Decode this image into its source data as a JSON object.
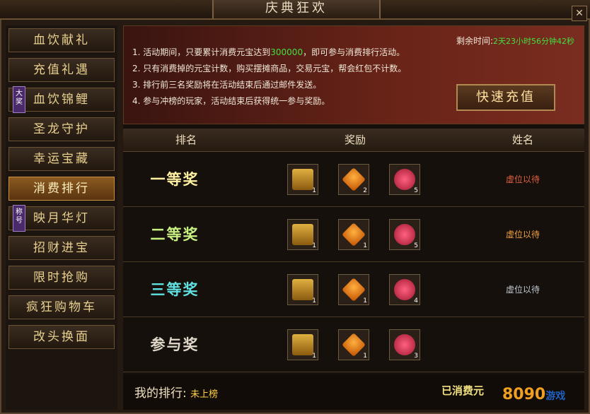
{
  "window": {
    "title": "庆典狂欢",
    "close_icon": "close-icon"
  },
  "sidebar": {
    "items": [
      {
        "label": "血饮献礼"
      },
      {
        "label": "充值礼遇"
      },
      {
        "label": "血饮锦鲤",
        "badge": "大奖"
      },
      {
        "label": "圣龙守护"
      },
      {
        "label": "幸运宝藏"
      },
      {
        "label": "消费排行",
        "active": true
      },
      {
        "label": "映月华灯",
        "badge": "称号"
      },
      {
        "label": "招财进宝"
      },
      {
        "label": "限时抢购"
      },
      {
        "label": "疯狂购物车"
      },
      {
        "label": "改头换面"
      }
    ]
  },
  "banner": {
    "rules": [
      {
        "a": "1. 活动期间，只要累计消费元宝达到",
        "hl": "300000",
        "b": "，即可参与消费排行活动。"
      },
      {
        "a": "2. 只有消费掉的元宝计数，购买摆摊商品，交易元宝，帮会红包不计数。"
      },
      {
        "a": "3. 排行前三名奖励将在活动结束后通过邮件发送。"
      },
      {
        "a": "4. 参与冲榜的玩家，活动结束后获得统一参与奖励。"
      }
    ],
    "remain_label": "剩余时间:",
    "remain_value": "2天23小时56分钟42秒",
    "recharge_label": "快速充值"
  },
  "table": {
    "headers": {
      "rank": "排名",
      "reward": "奖励",
      "name": "姓名"
    },
    "rows": [
      {
        "rank": "一等奖",
        "color": "#fff0a0",
        "items": [
          {
            "icon": "chest-icon",
            "count": "1"
          },
          {
            "icon": "gem-icon",
            "count": "2"
          },
          {
            "icon": "rose-icon",
            "count": "5"
          }
        ],
        "name": "虚位以待",
        "name_color": "#e06040"
      },
      {
        "rank": "二等奖",
        "color": "#c8f080",
        "items": [
          {
            "icon": "chest-icon",
            "count": "1"
          },
          {
            "icon": "gem-icon",
            "count": "1"
          },
          {
            "icon": "rose-icon",
            "count": "5"
          }
        ],
        "name": "虚位以待",
        "name_color": "#f0a040"
      },
      {
        "rank": "三等奖",
        "color": "#60e0e0",
        "items": [
          {
            "icon": "chest-icon",
            "count": "1"
          },
          {
            "icon": "gem-icon",
            "count": "1"
          },
          {
            "icon": "rose-icon",
            "count": "4"
          }
        ],
        "name": "虚位以待",
        "name_color": "#c0c8d0"
      },
      {
        "rank": "参与奖",
        "color": "#e0d8c8",
        "items": [
          {
            "icon": "chest-icon",
            "count": "1"
          },
          {
            "icon": "gem-icon",
            "count": "1"
          },
          {
            "icon": "rose-icon",
            "count": "3"
          }
        ],
        "name": "",
        "name_color": "#c0c0c0"
      }
    ]
  },
  "footer": {
    "my_rank_label": "我的排行:",
    "my_rank_value": "未上榜",
    "spent_label": "已消费元"
  },
  "logo": {
    "text": "8090",
    "suffix": "游戏"
  }
}
